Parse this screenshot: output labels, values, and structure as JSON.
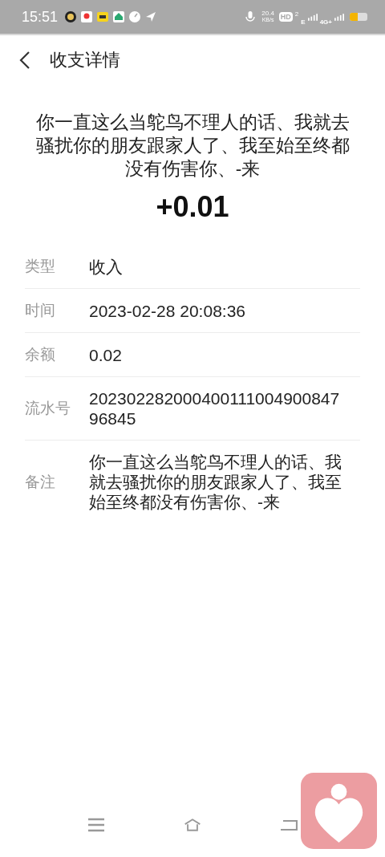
{
  "status_bar": {
    "time": "15:51",
    "speed_value": "20.4",
    "speed_unit": "KB/s",
    "hd": "HD",
    "hd_sub": "2",
    "network_1": "E",
    "network_2": "4G+"
  },
  "header": {
    "title": "收支详情"
  },
  "summary": {
    "remark": "你一直这么当鸵鸟不理人的话、我就去骚扰你的朋友跟家人了、我至始至终都没有伤害你、-来",
    "amount": "+0.01"
  },
  "details": [
    {
      "label": "类型",
      "value": "收入"
    },
    {
      "label": "时间",
      "value": "2023-02-28 20:08:36"
    },
    {
      "label": "余额",
      "value": "0.02"
    },
    {
      "label": "流水号",
      "value": "20230228200040011100490084796845"
    },
    {
      "label": "备注",
      "value": "你一直这么当鸵鸟不理人的话、我就去骚扰你的朋友跟家人了、我至始至终都没有伤害你、-来"
    }
  ]
}
